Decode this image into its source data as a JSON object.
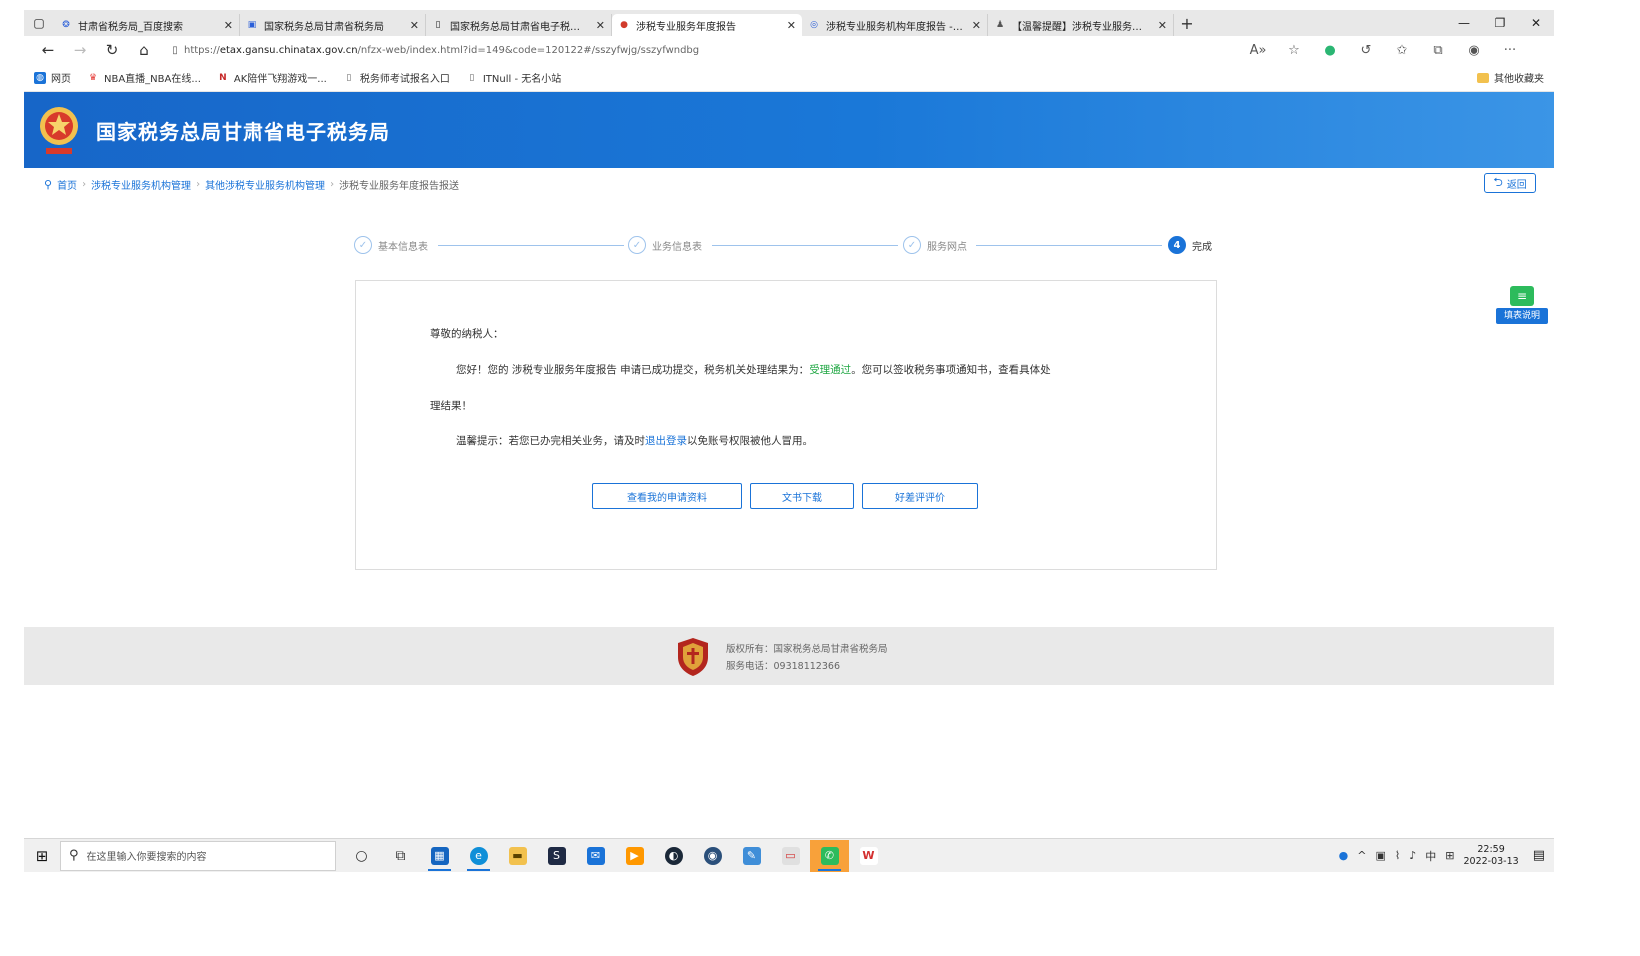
{
  "browser": {
    "tabs": [
      {
        "title": "甘肃省税务局_百度搜索",
        "icon": "search-icon",
        "active": false
      },
      {
        "title": "国家税务总局甘肃省税务局",
        "icon": "page-icon",
        "active": false
      },
      {
        "title": "国家税务总局甘肃省电子税务局",
        "icon": "page-icon",
        "active": false
      },
      {
        "title": "涉税专业服务年度报告",
        "icon": "tax-emblem-icon",
        "active": true
      },
      {
        "title": "涉税专业服务机构年度报告 - 百",
        "icon": "search-icon",
        "active": false
      },
      {
        "title": "【温馨提醒】涉税专业服务机构",
        "icon": "page-icon",
        "active": false
      }
    ],
    "url_scheme": "https://",
    "url_host": "etax.gansu.chinatax.gov.cn",
    "url_path": "/nfzx-web/index.html?id=149&code=120122#/sszyfwjg/sszyfwndbg",
    "bookmarks": [
      {
        "label": "网页",
        "color": "#1a73d8"
      },
      {
        "label": "NBA直播_NBA在线...",
        "color": "#e53935"
      },
      {
        "label": "AK陪伴飞翔游戏一...",
        "color": "#c62828"
      },
      {
        "label": "税务师考试报名入口",
        "color": "#888888"
      },
      {
        "label": "ITNull - 无名小站",
        "color": "#888888"
      }
    ],
    "other_bookmarks": "其他收藏夹"
  },
  "site": {
    "title": "国家税务总局甘肃省电子税务局",
    "breadcrumb": [
      "首页",
      "涉税专业服务机构管理",
      "其他涉税专业服务机构管理",
      "涉税专业服务年度报告报送"
    ],
    "back_label": "返回"
  },
  "steps": [
    {
      "label": "基本信息表",
      "status": "done"
    },
    {
      "label": "业务信息表",
      "status": "done"
    },
    {
      "label": "服务网点",
      "status": "done"
    },
    {
      "label": "完成",
      "status": "current",
      "number": "4"
    }
  ],
  "result": {
    "greeting": "尊敬的纳税人：",
    "line1_prefix": "您好！您的 涉税专业服务年度报告 申请已成功提交，税务机关处理结果为：",
    "status_text": "受理通过",
    "line1_suffix": "。您可以签收税务事项通知书，查看具体处",
    "line2": "理结果！",
    "line3_prefix": "温馨提示：若您已办完相关业务，请及时",
    "logout_link": "退出登录",
    "line3_suffix": "以免账号权限被他人冒用。",
    "buttons": [
      "查看我的申请资料",
      "文书下载",
      "好差评评价"
    ]
  },
  "side_widget": {
    "label": "填表说明"
  },
  "footer": {
    "owner": "版权所有：国家税务总局甘肃省税务局",
    "phone": "服务电话：09318112366"
  },
  "taskbar": {
    "search_placeholder": "在这里输入你要搜索的内容",
    "time": "22:59",
    "date": "2022-03-13",
    "ime": "中"
  },
  "colors": {
    "brand_blue": "#1a73d8",
    "success_green": "#22a845"
  }
}
